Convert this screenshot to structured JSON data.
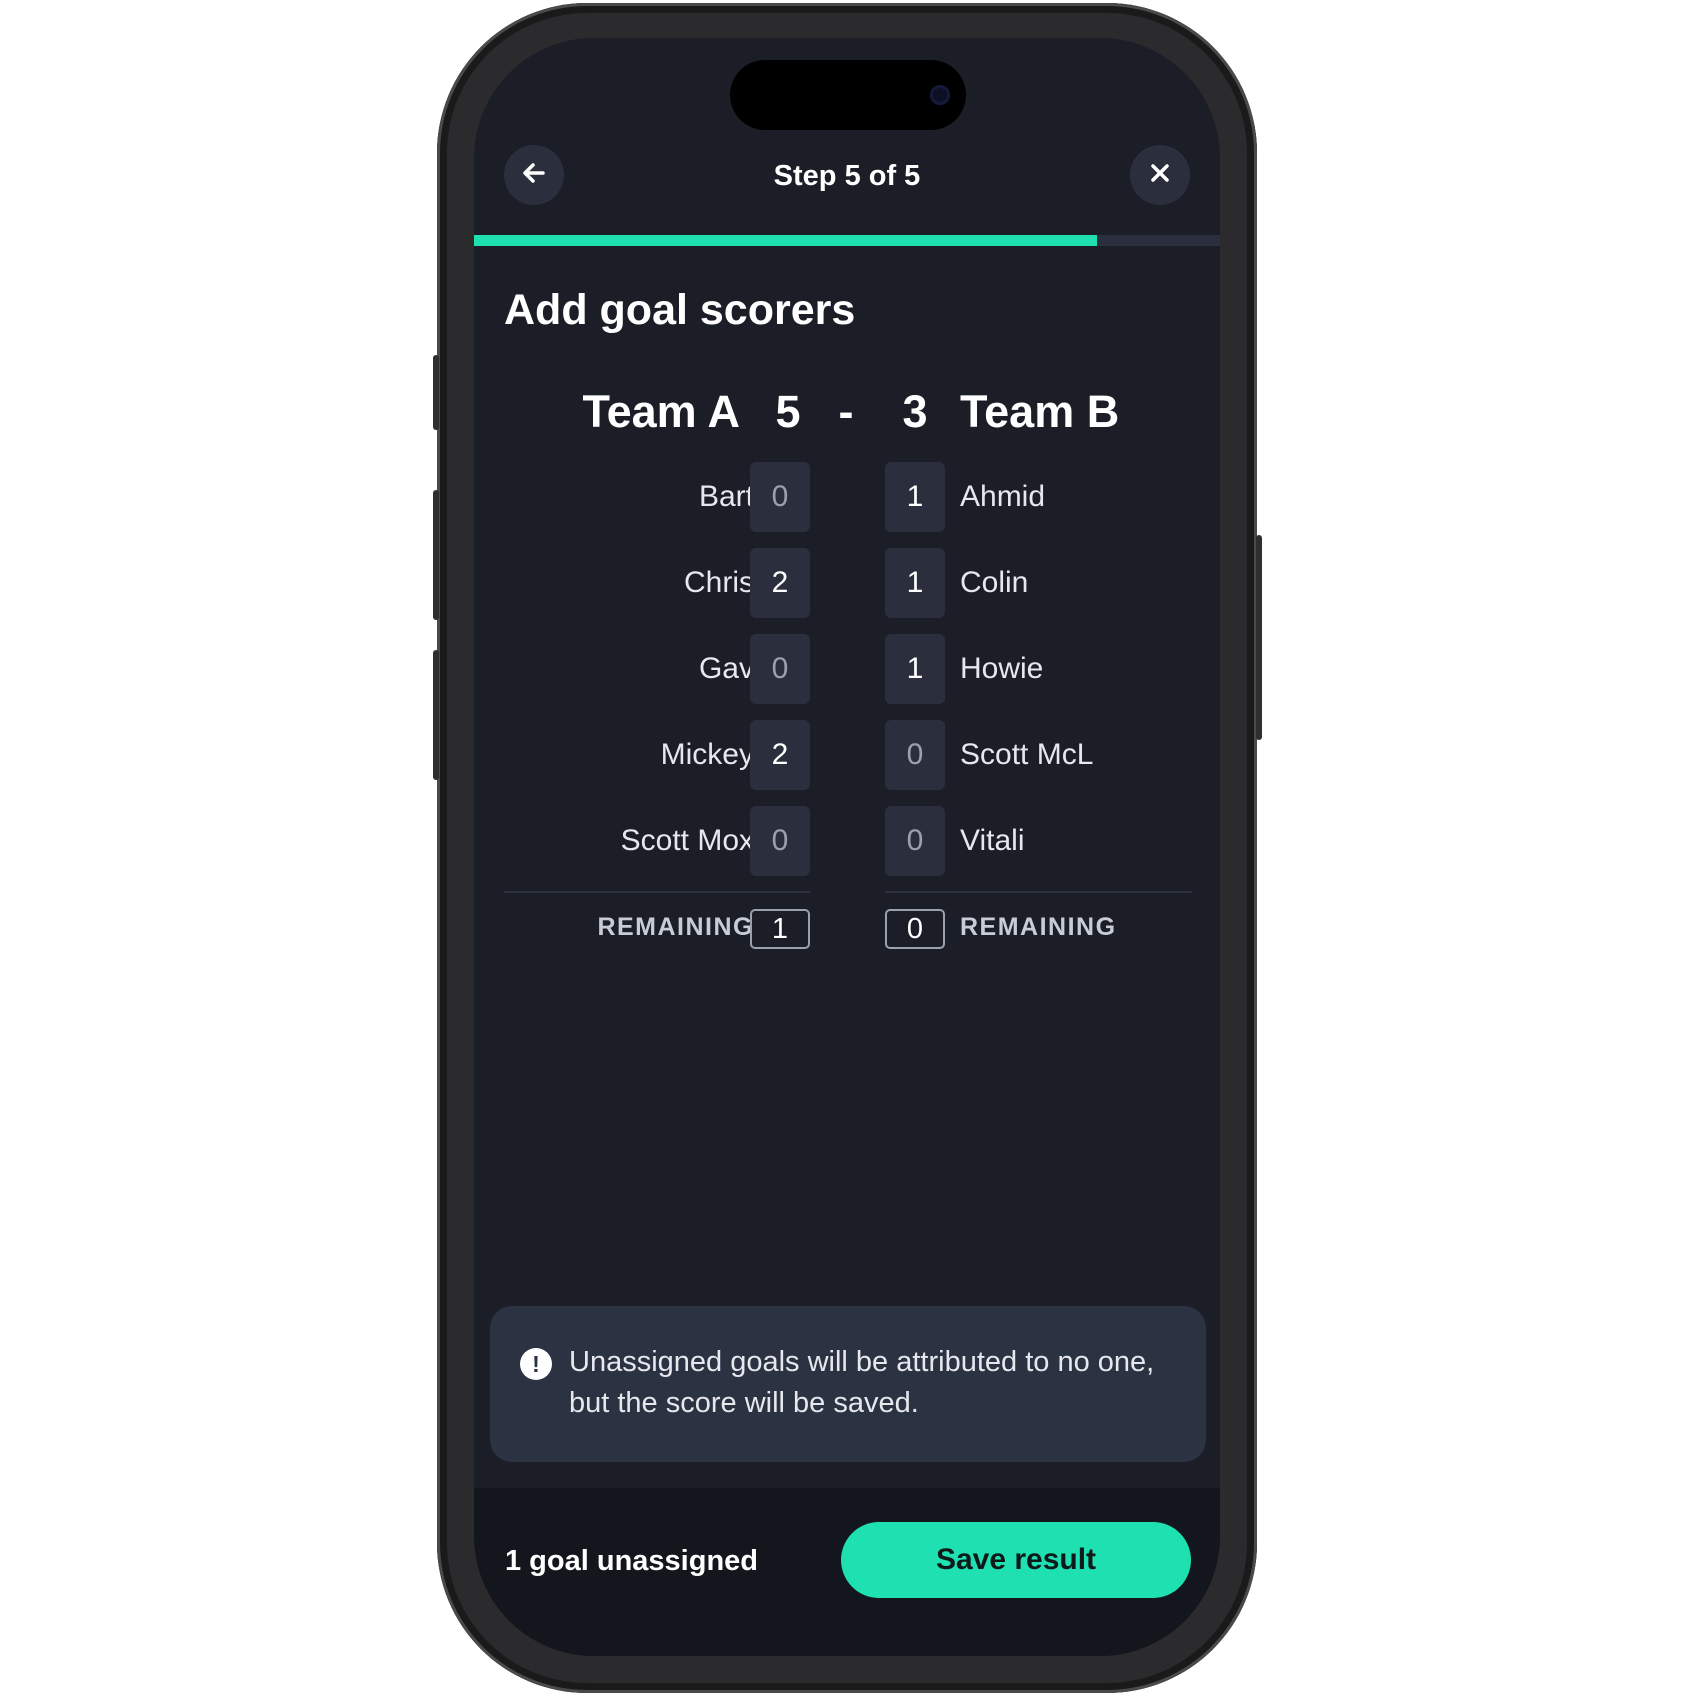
{
  "header": {
    "step_label": "Step 5 of 5",
    "back_icon": "arrow-left-icon",
    "close_icon": "close-icon",
    "progress_fraction": 0.835
  },
  "page_title": "Add goal scorers",
  "match": {
    "team_a": {
      "name": "Team A",
      "score": "5"
    },
    "separator": "-",
    "team_b": {
      "name": "Team B",
      "score": "3"
    }
  },
  "team_a_players": [
    {
      "name": "Bart",
      "goals": "0"
    },
    {
      "name": "Chris",
      "goals": "2"
    },
    {
      "name": "Gav",
      "goals": "0"
    },
    {
      "name": "Mickey",
      "goals": "2"
    },
    {
      "name": "Scott Mox",
      "goals": "0"
    }
  ],
  "team_b_players": [
    {
      "name": "Ahmid",
      "goals": "1"
    },
    {
      "name": "Colin",
      "goals": "1"
    },
    {
      "name": "Howie",
      "goals": "1"
    },
    {
      "name": "Scott McL",
      "goals": "0"
    },
    {
      "name": "Vitali",
      "goals": "0"
    }
  ],
  "remaining": {
    "label": "REMAINING",
    "team_a": "1",
    "team_b": "0"
  },
  "notice": {
    "icon": "exclamation-circle-icon",
    "text": "Unassigned goals will be attributed to no one, but the score will be saved."
  },
  "footer": {
    "status": "1 goal unassigned",
    "save_label": "Save result"
  },
  "colors": {
    "accent": "#1fe0b0",
    "background": "#1b1d27",
    "card": "#2b2f3d"
  }
}
